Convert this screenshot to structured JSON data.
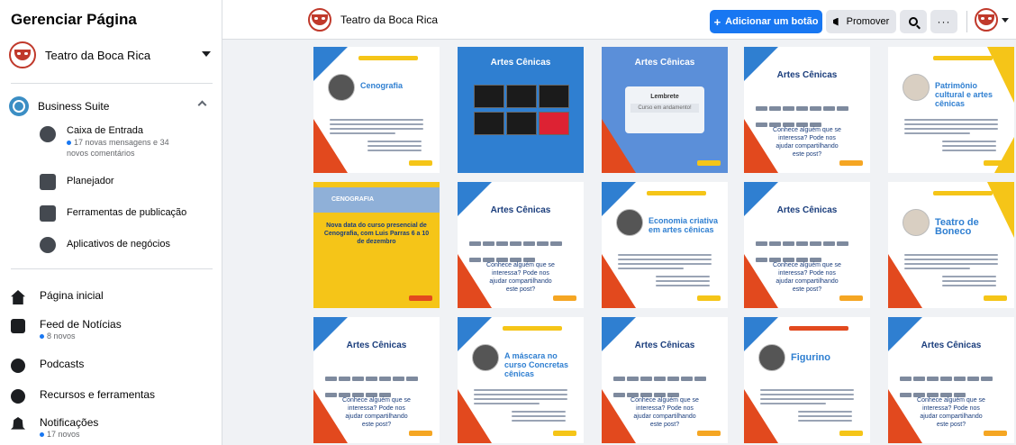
{
  "sidebar": {
    "title": "Gerenciar Página",
    "page_name": "Teatro da Boca Rica",
    "business_suite": "Business Suite",
    "suite_items": [
      {
        "label": "Caixa de Entrada",
        "sub": "17 novas mensagens e 34 novos comentários"
      },
      {
        "label": "Planejador",
        "sub": ""
      },
      {
        "label": "Ferramentas de publicação",
        "sub": ""
      },
      {
        "label": "Aplicativos de negócios",
        "sub": ""
      }
    ],
    "nav_items": [
      {
        "label": "Página inicial",
        "sub": ""
      },
      {
        "label": "Feed de Notícias",
        "sub": "8 novos"
      },
      {
        "label": "Podcasts",
        "sub": ""
      },
      {
        "label": "Recursos e ferramentas",
        "sub": ""
      },
      {
        "label": "Notificações",
        "sub": "17 novos"
      }
    ]
  },
  "topbar": {
    "page_name": "Teatro da Boca Rica",
    "add_button": "Adicionar um botão",
    "promote_button": "Promover",
    "more_label": "···"
  },
  "tiles": [
    {
      "title": "Cenografia"
    },
    {
      "title": "Artes Cênicas"
    },
    {
      "title": "Artes Cênicas",
      "card_title": "Lembrete",
      "card_field": "Curso em andamento!"
    },
    {
      "title": "Artes Cênicas",
      "question": "Conhece alguém que se interessa? Pode nos ajudar compartilhando este post?"
    },
    {
      "title": "Patrimônio cultural e artes cênicas"
    },
    {
      "title": "CENOGRAFIA",
      "text": "Nova data do curso presencial de Cenografia, com Luis Parras 6 a 10 de dezembro"
    },
    {
      "title": "Artes Cênicas",
      "question": "Conhece alguém que se interessa? Pode nos ajudar compartilhando este post?"
    },
    {
      "title": "Economia criativa em artes cênicas"
    },
    {
      "title": "Artes Cênicas",
      "question": "Conhece alguém que se interessa? Pode nos ajudar compartilhando este post?"
    },
    {
      "title": "Teatro de Boneco"
    },
    {
      "title": "Artes Cênicas",
      "question": "Conhece alguém que se interessa? Pode nos ajudar compartilhando este post?"
    },
    {
      "title": "A máscara no curso Concretas cênicas"
    },
    {
      "title": "Artes Cênicas",
      "question": "Conhece alguém que se interessa? Pode nos ajudar compartilhando este post?"
    },
    {
      "title": "Figurino"
    },
    {
      "title": "Artes Cênicas",
      "question": "Conhece alguém que se interessa? Pode nos ajudar compartilhando este post?"
    }
  ]
}
